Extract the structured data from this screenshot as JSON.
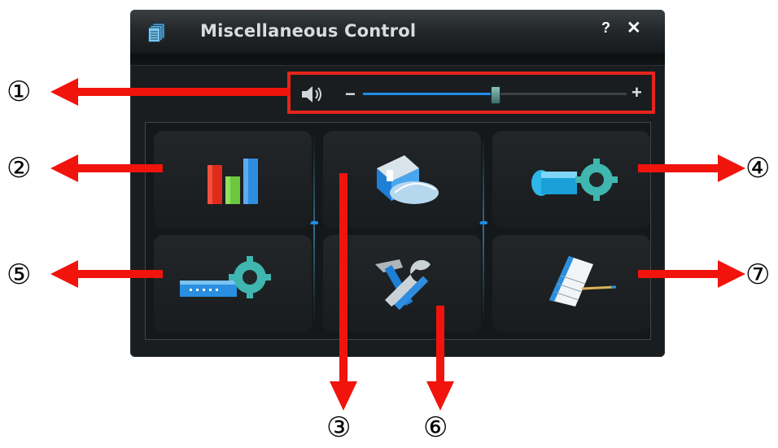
{
  "window": {
    "title": "Miscellaneous Control",
    "help_label": "?",
    "close_label": "✕"
  },
  "volume": {
    "minus_label": "−",
    "plus_label": "+",
    "level": 0.5
  },
  "panel_buttons": [
    {
      "icon": "bar-chart-icon"
    },
    {
      "icon": "hdd-backup-icon"
    },
    {
      "icon": "camera-settings-icon"
    },
    {
      "icon": "network-settings-icon"
    },
    {
      "icon": "tools-icon"
    },
    {
      "icon": "calendar-icon"
    }
  ],
  "annotations": [
    "①",
    "②",
    "③",
    "④",
    "⑤",
    "⑥",
    "⑦"
  ],
  "colors": {
    "highlight": "#e5251b",
    "accent": "#1f8ce8",
    "window_bg": "#1a1d1f"
  }
}
